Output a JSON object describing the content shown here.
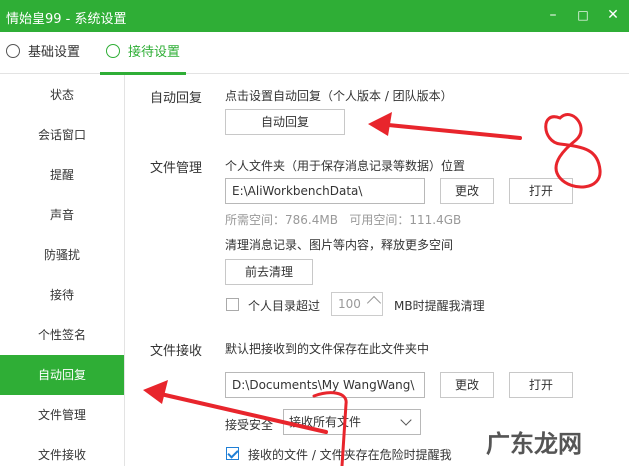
{
  "window": {
    "title": "情始皇99 - 系统设置",
    "min_icon": "–",
    "max_icon": "□",
    "close_icon": "✕"
  },
  "tabs": [
    {
      "label": "基础设置",
      "icon": "gear-icon"
    },
    {
      "label": "接待设置",
      "icon": "reception-icon"
    }
  ],
  "sidebar": {
    "items": [
      {
        "label": "状态"
      },
      {
        "label": "会话窗口"
      },
      {
        "label": "提醒"
      },
      {
        "label": "声音"
      },
      {
        "label": "防骚扰"
      },
      {
        "label": "接待"
      },
      {
        "label": "个性签名"
      },
      {
        "label": "自动回复"
      },
      {
        "label": "文件管理"
      },
      {
        "label": "文件接收"
      }
    ]
  },
  "auto_reply": {
    "section_label": "自动回复",
    "hint": "点击设置自动回复（个人版本 / 团队版本）",
    "button": "自动回复"
  },
  "file_manage": {
    "section_label": "文件管理",
    "hint": "个人文件夹（用于保存消息记录等数据）位置",
    "path": "E:\\AliWorkbenchData\\",
    "change_button": "更改",
    "open_button": "打开",
    "space_info": "所需空间：786.4MB   可用空间：111.4GB",
    "clean_hint": "清理消息记录、图片等内容，释放更多空间",
    "clean_button": "前去清理",
    "remind_prefix": "个人目录超过",
    "remind_value": "100",
    "remind_suffix": "MB时提醒我清理"
  },
  "file_receive": {
    "section_label": "文件接收",
    "hint": "默认把接收到的文件保存在此文件夹中",
    "path": "D:\\Documents\\My WangWang\\",
    "change_button": "更改",
    "open_button": "打开",
    "security_label": "接受安全",
    "security_value": "接收所有文件",
    "danger_remind": "接收的文件 / 文件夹存在危险时提醒我"
  },
  "annotation": {
    "number": "8"
  },
  "watermark": "广东龙网",
  "colors": {
    "brand": "#2fae36",
    "annotation": "#e8252c"
  }
}
